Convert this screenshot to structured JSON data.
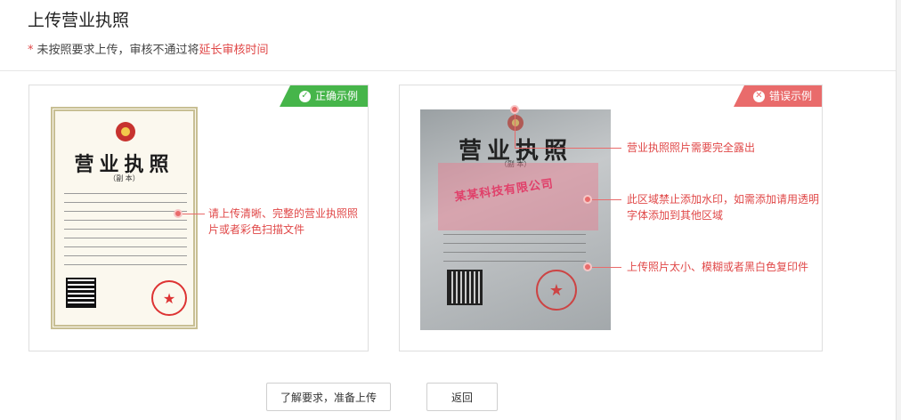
{
  "header": {
    "title": "上传营业执照",
    "notice_star": "*",
    "notice_text": "未按照要求上传，审核不通过将",
    "notice_warn": "延长审核时间"
  },
  "correct_example": {
    "tag_label": "正确示例",
    "tag_icon": "check-circle-icon",
    "cert_title": "营业执照",
    "cert_subtitle": "（副 本）",
    "callout": "请上传清晰、完整的营业执照照片或者彩色扫描文件"
  },
  "wrong_example": {
    "tag_label": "错误示例",
    "tag_icon": "x-circle-icon",
    "cert_title": "营业执照",
    "cert_subtitle": "（副 本）",
    "watermark": "某某科技有限公司",
    "callouts": [
      "营业执照照片需要完全露出",
      "此区域禁止添加水印，如需添加请用透明字体添加到其他区域",
      "上传照片太小、模糊或者黑白色复印件"
    ]
  },
  "actions": {
    "confirm_label": "了解要求，准备上传",
    "back_label": "返回"
  },
  "colors": {
    "correct_green": "#46b54a",
    "wrong_red": "#e96b6b",
    "warn_text": "#e04848"
  }
}
